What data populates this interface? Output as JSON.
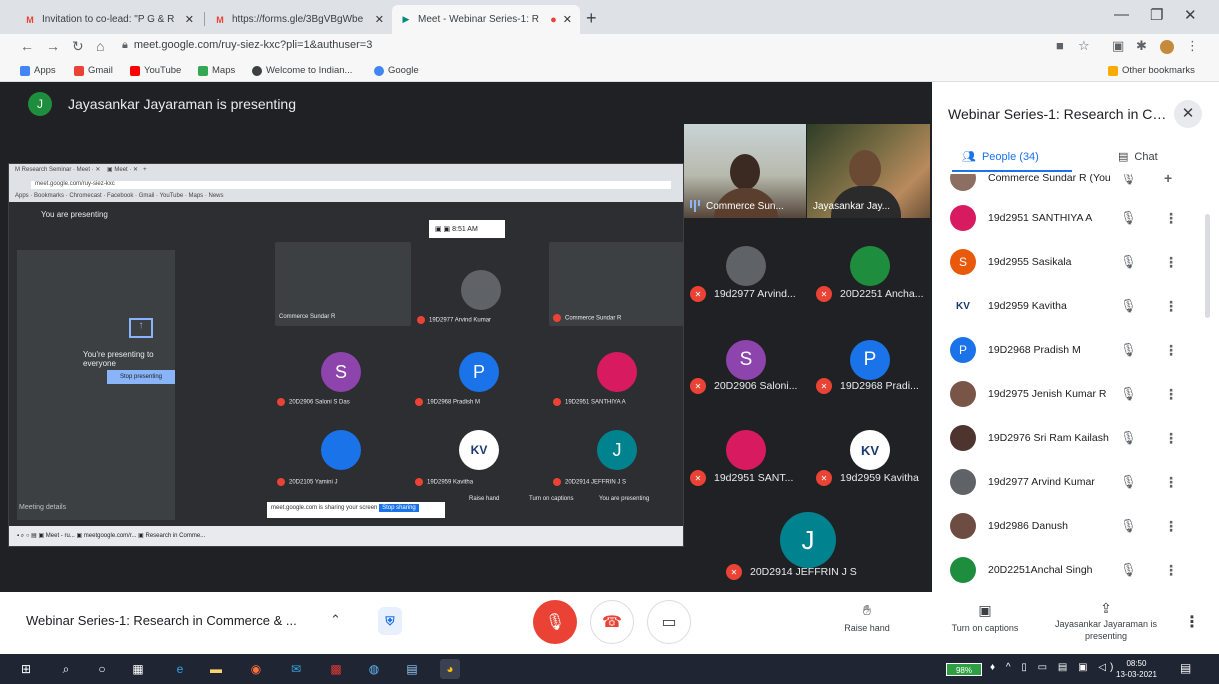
{
  "browser": {
    "tabs": [
      {
        "label": "Invitation to co-lead: \"P G & R",
        "icon": "gmail-icon"
      },
      {
        "label": "https://forms.gle/3BgVBgWbe",
        "icon": "gmail-icon"
      },
      {
        "label": "Meet - Webinar Series-1: R",
        "icon": "meet-icon"
      }
    ],
    "url": "meet.google.com/ruy-siez-kxc?pli=1&authuser=3",
    "bookmarks": [
      "Apps",
      "Gmail",
      "YouTube",
      "Maps",
      "Welcome to Indian...",
      "Google"
    ],
    "other_bookmarks": "Other bookmarks"
  },
  "meet": {
    "presenting_banner": "Jayasankar Jayaraman is presenting",
    "presenter_initial": "J",
    "video_tiles": [
      {
        "name": "Commerce Sun...",
        "type": "woman"
      },
      {
        "name": "Jayasankar Jay...",
        "type": "man"
      }
    ],
    "grid": [
      {
        "name": "19d2977 Arvind...",
        "initial": "",
        "color": "#5f6368"
      },
      {
        "name": "20D2251 Ancha...",
        "initial": "",
        "color": "#1e8e3e"
      },
      {
        "name": "20D2906 Saloni...",
        "initial": "S",
        "color": "#8e44ad"
      },
      {
        "name": "19D2968 Pradi...",
        "initial": "P",
        "color": "#1a73e8"
      },
      {
        "name": "19d2951 SANT...",
        "initial": "",
        "color": "#d81b60"
      },
      {
        "name": "19d2959 Kavitha",
        "initial": "KV",
        "color": "#ffffff"
      },
      {
        "name": "20D2914 JEFFRIN J S",
        "initial": "J",
        "color": "#00838f"
      }
    ],
    "share": {
      "you_presenting": "You are presenting",
      "presenting_everyone": "You're presenting to everyone",
      "stop_presenting": "Stop presenting",
      "meeting_details": "Meeting details",
      "notice": "meet.google.com is sharing your screen",
      "notice_btn": "Stop sharing",
      "time": "8:51 AM",
      "mini_tiles": [
        {
          "name": "Commerce Sundar R",
          "initial": ""
        },
        {
          "name": "19D2977 Arvind Kumar",
          "initial": ""
        },
        {
          "name": "Commerce Sundar R",
          "initial": ""
        },
        {
          "name": "20D2906 Saloni S Das",
          "initial": "S",
          "color": "#8e44ad"
        },
        {
          "name": "19D2968 Pradish M",
          "initial": "P",
          "color": "#1a73e8"
        },
        {
          "name": "19D2951 SANTHIYA A",
          "initial": "",
          "color": "#d81b60"
        },
        {
          "name": "20D2105 Yamini J",
          "initial": "",
          "color": "#1a73e8"
        },
        {
          "name": "19D2959 Kavitha",
          "initial": "KV",
          "color": "#ffffff"
        },
        {
          "name": "20D2914 JEFFRIN J S",
          "initial": "J",
          "color": "#00838f"
        }
      ],
      "controls": [
        "Raise hand",
        "Turn on captions",
        "You are presenting"
      ]
    }
  },
  "panel": {
    "title": "Webinar Series-1: Research in Co...",
    "people_tab": "People (34)",
    "chat_tab": "Chat",
    "partial_row": "Commerce Sundar R (You)",
    "people": [
      {
        "name": "19d2951 SANTHIYA A",
        "initial": "",
        "color": "#d81b60"
      },
      {
        "name": "19d2955 Sasikala",
        "initial": "S",
        "color": "#e8590c"
      },
      {
        "name": "19d2959 Kavitha",
        "initial": "KV",
        "color": "#ffffff"
      },
      {
        "name": "19D2968 Pradish M",
        "initial": "P",
        "color": "#1a73e8"
      },
      {
        "name": "19d2975 Jenish Kumar R",
        "initial": "",
        "color": "#795548"
      },
      {
        "name": "19D2976 Sri Ram Kailash",
        "initial": "",
        "color": "#4e342e"
      },
      {
        "name": "19d2977 Arvind Kumar",
        "initial": "",
        "color": "#5f6368"
      },
      {
        "name": "19d2986 Danush",
        "initial": "",
        "color": "#6d4c41"
      },
      {
        "name": "20D2251Anchal Singh",
        "initial": "",
        "color": "#1e8e3e"
      }
    ]
  },
  "bottom": {
    "meeting_title": "Webinar Series-1: Research in Commerce & ...",
    "raise_hand": "Raise hand",
    "captions": "Turn on captions",
    "presenting": "Jayasankar Jayaraman is presenting"
  },
  "taskbar": {
    "battery": "98%",
    "time": "08:50",
    "date": "13-03-2021"
  }
}
